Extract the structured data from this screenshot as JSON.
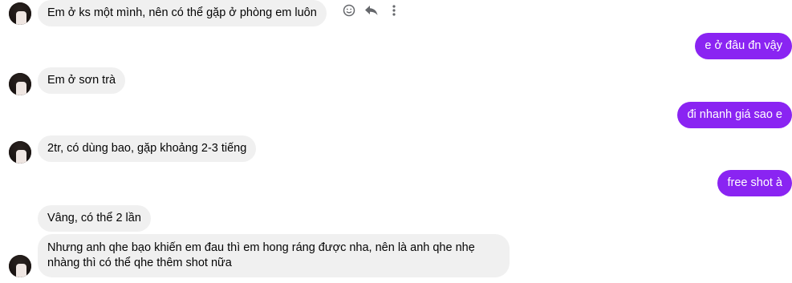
{
  "colors": {
    "outgoing_bubble": "#8a24f2",
    "incoming_bubble": "#f0f0f0"
  },
  "messages": [
    {
      "side": "in",
      "text": "Em ở ks một mình, nên có thể gặp ở phòng em luôn"
    },
    {
      "side": "out",
      "text": "e ở đâu đn vậy"
    },
    {
      "side": "in",
      "text": "Em ở sơn trà"
    },
    {
      "side": "out",
      "text": "đi nhanh giá sao e"
    },
    {
      "side": "in",
      "text": "2tr, có dùng bao, gặp khoảng 2-3 tiếng"
    },
    {
      "side": "out",
      "text": "free shot à"
    },
    {
      "side": "in",
      "text": "Vâng, có thể 2 lần"
    },
    {
      "side": "in",
      "text": "Nhưng anh qhe bạo khiến em đau thì em hong ráng được nha, nên là anh qhe nhẹ nhàng thì có thể qhe thêm shot nữa"
    }
  ],
  "message_actions": [
    "smile-icon",
    "reply-icon",
    "more-icon"
  ]
}
